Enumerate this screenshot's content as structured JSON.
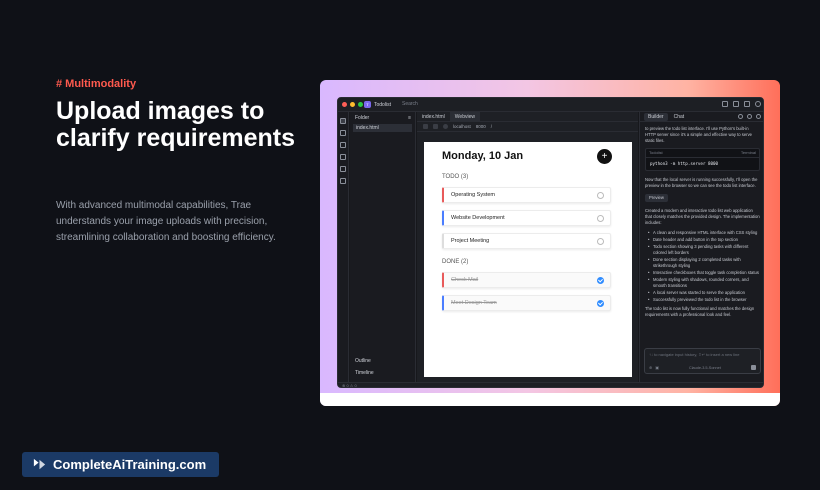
{
  "hero": {
    "tag": "# Multimodality",
    "headline": "Upload images to clarify requirements",
    "description": "With advanced multimodal capabilities, Trae understands your image uploads with precision, streamlining collaboration and boosting efficiency."
  },
  "brand": {
    "text": "CompleteAiTraining.com"
  },
  "ide": {
    "project": "Todolist",
    "project_badge": "T",
    "search_placeholder": "Search",
    "explorer": {
      "header": "Folder",
      "file": "index.html",
      "outline": "Outline",
      "timeline": "Timeline"
    },
    "editor": {
      "tabs": [
        "index.html",
        "Webview"
      ],
      "url": "localhost",
      "port": "8000",
      "path": "/"
    },
    "preview": {
      "title": "Monday, 10 Jan",
      "add_label": "+",
      "todo_heading": "TODO (3)",
      "todo": [
        {
          "label": "Operating System",
          "color": "#e85a5a"
        },
        {
          "label": "Website Development",
          "color": "#4a7dff"
        },
        {
          "label": "Project Meeting",
          "color": "#dddddd"
        }
      ],
      "done_heading": "DONE (2)",
      "done": [
        {
          "label": "Check Mail",
          "color": "#e85a5a"
        },
        {
          "label": "Meet Design Team",
          "color": "#4a7dff"
        }
      ]
    },
    "chat": {
      "tabs": [
        "Builder",
        "Chat"
      ],
      "intro": "to preview the todo list interface. I'll use Python's built-in HTTP server since it's a simple and effective way to serve static files.",
      "code_label": "Todolist",
      "code_action": "Terminal",
      "code": "python3 -m http.server 8000",
      "after_code": "Now that the local server is running successfully, I'll open the preview in the browser so we can see the todo list interface.",
      "preview_button": "Preview",
      "summary": "Created a modern and interactive todo list web application that closely matches the provided design. The implementation includes:",
      "bullets": [
        "A clean and responsive HTML interface with CSS styling",
        "Date header and add button in the top section",
        "Todo section showing 3 pending tasks with different colored left borders",
        "Done section displaying 2 completed tasks with strikethrough styling",
        "Interactive checkboxes that toggle task completion status",
        "Modern styling with shadows, rounded corners, and smooth transitions",
        "A local server was started to serve the application",
        "Successfully previewed the todo list in the browser"
      ],
      "closing": "The todo list is now fully functional and matches the design requirements with a professional look and feel.",
      "input_placeholder": "↑↓ to navigate input history, ⇧↵ to insert a new line",
      "input_hint": "Claude-3.5-Sonnet"
    }
  },
  "colors": {
    "accent": "#ff5a4e",
    "brand_bg": "#1b3a66"
  }
}
